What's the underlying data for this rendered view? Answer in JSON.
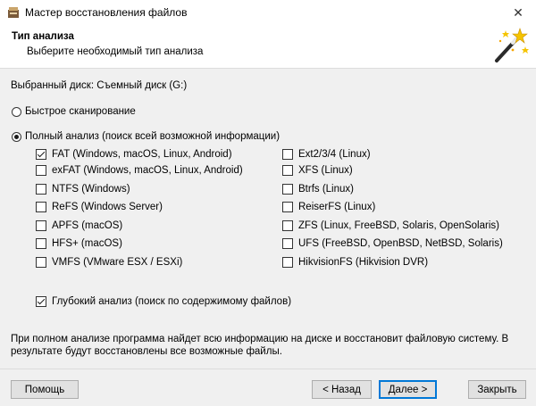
{
  "window": {
    "title": "Мастер восстановления файлов",
    "close_glyph": "✕"
  },
  "header": {
    "title": "Тип анализа",
    "subtitle": "Выберите необходимый тип анализа"
  },
  "body": {
    "selected_disk": "Выбранный диск: Съемный диск (G:)",
    "quick_scan": {
      "label": "Быстрое сканирование",
      "selected": false
    },
    "full_scan": {
      "label": "Полный анализ (поиск всей возможной информации)",
      "selected": true
    },
    "fs_left": [
      {
        "label": "FAT (Windows, macOS, Linux, Android)",
        "checked": true
      },
      {
        "label": "exFAT (Windows, macOS, Linux, Android)",
        "checked": false
      },
      {
        "label": "NTFS (Windows)",
        "checked": false
      },
      {
        "label": "ReFS (Windows Server)",
        "checked": false
      },
      {
        "label": "APFS (macOS)",
        "checked": false
      },
      {
        "label": "HFS+ (macOS)",
        "checked": false
      },
      {
        "label": "VMFS (VMware ESX / ESXi)",
        "checked": false
      }
    ],
    "fs_right": [
      {
        "label": "Ext2/3/4 (Linux)",
        "checked": false
      },
      {
        "label": "XFS (Linux)",
        "checked": false
      },
      {
        "label": "Btrfs (Linux)",
        "checked": false
      },
      {
        "label": "ReiserFS (Linux)",
        "checked": false
      },
      {
        "label": "ZFS (Linux, FreeBSD, Solaris, OpenSolaris)",
        "checked": false
      },
      {
        "label": "UFS (FreeBSD, OpenBSD, NetBSD, Solaris)",
        "checked": false
      },
      {
        "label": "HikvisionFS (Hikvision DVR)",
        "checked": false
      }
    ],
    "deep_scan": {
      "label": "Глубокий анализ (поиск по содержимому файлов)",
      "checked": true
    },
    "info": "При полном анализе программа найдет всю информацию на диске и восстановит файловую систему. В результате будут восстановлены все возможные файлы."
  },
  "footer": {
    "help": "Помощь",
    "back": "< Назад",
    "next": "Далее >",
    "close": "Закрыть"
  },
  "icons": {
    "app": "wizard-app-icon",
    "header": "magic-wand-icon"
  }
}
